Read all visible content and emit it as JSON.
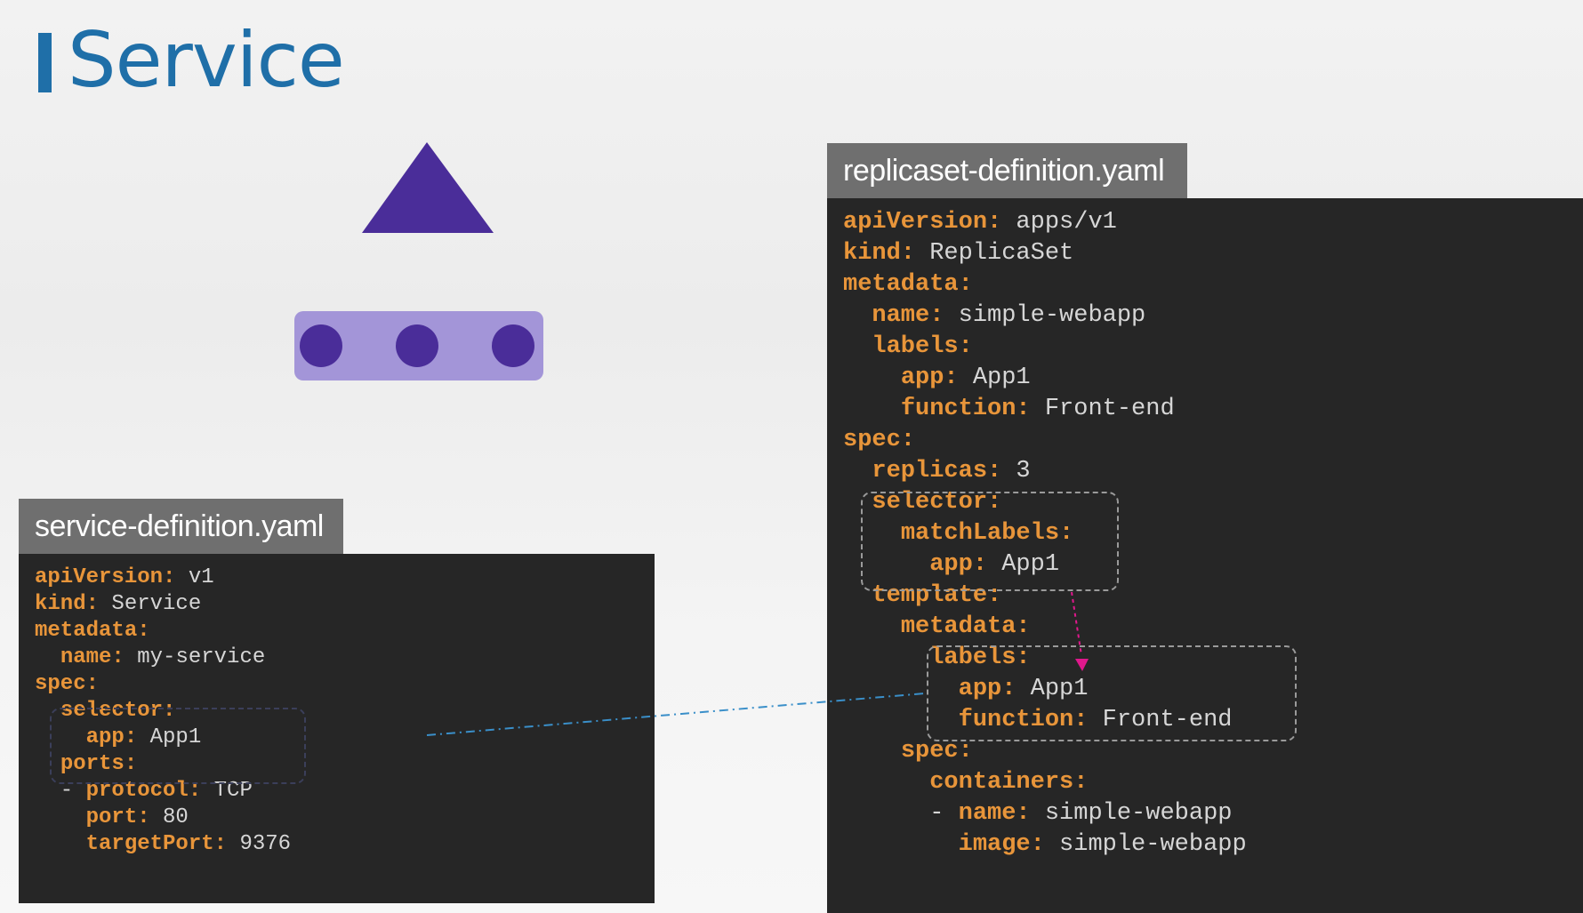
{
  "page": {
    "title": "Service"
  },
  "colors": {
    "accent_blue": "#1f6fa8",
    "triangle": "#4a2d99",
    "pod_group_bg": "#a395d8",
    "pod": "#4a2d99",
    "connector_blue": "#3a8fc9",
    "arrow_magenta": "#e0188c",
    "yaml_key": "#e8953a",
    "yaml_value": "#d6d6d6",
    "code_bg": "#262626",
    "tab_bg": "#6f6f6f"
  },
  "diagram": {
    "service_icon": "triangle-icon",
    "pods_count": 3
  },
  "service_file": {
    "tab_label": "service-definition.yaml",
    "lines": [
      {
        "indent": "",
        "key": "apiVersion:",
        "value": " v1"
      },
      {
        "indent": "",
        "key": "kind:",
        "value": " Service"
      },
      {
        "indent": "",
        "key": "metadata:",
        "value": ""
      },
      {
        "indent": "  ",
        "key": "name:",
        "value": " my-service"
      },
      {
        "indent": "",
        "key": "spec:",
        "value": ""
      },
      {
        "indent": "  ",
        "key": "selector:",
        "value": ""
      },
      {
        "indent": "    ",
        "key": "app:",
        "value": " App1"
      },
      {
        "indent": "  ",
        "key": "ports:",
        "value": ""
      },
      {
        "indent": "  - ",
        "key": "protocol:",
        "value": " TCP"
      },
      {
        "indent": "    ",
        "key": "port:",
        "value": " 80"
      },
      {
        "indent": "    ",
        "key": "targetPort:",
        "value": " 9376"
      }
    ]
  },
  "replicaset_file": {
    "tab_label": "replicaset-definition.yaml",
    "lines": [
      {
        "indent": "",
        "key": "apiVersion:",
        "value": " apps/v1"
      },
      {
        "indent": "",
        "key": "kind:",
        "value": " ReplicaSet"
      },
      {
        "indent": "",
        "key": "metadata:",
        "value": ""
      },
      {
        "indent": "  ",
        "key": "name:",
        "value": " simple-webapp"
      },
      {
        "indent": "  ",
        "key": "labels:",
        "value": ""
      },
      {
        "indent": "    ",
        "key": "app:",
        "value": " App1"
      },
      {
        "indent": "    ",
        "key": "function:",
        "value": " Front-end"
      },
      {
        "indent": "",
        "key": "spec:",
        "value": ""
      },
      {
        "indent": "  ",
        "key": "replicas:",
        "value": " 3"
      },
      {
        "indent": "  ",
        "key": "selector:",
        "value": ""
      },
      {
        "indent": "    ",
        "key": "matchLabels:",
        "value": ""
      },
      {
        "indent": "      ",
        "key": "app:",
        "value": " App1"
      },
      {
        "indent": "  ",
        "key": "template:",
        "value": ""
      },
      {
        "indent": "    ",
        "key": "metadata:",
        "value": ""
      },
      {
        "indent": "      ",
        "key": "labels:",
        "value": ""
      },
      {
        "indent": "        ",
        "key": "app:",
        "value": " App1"
      },
      {
        "indent": "        ",
        "key": "function:",
        "value": " Front-end"
      },
      {
        "indent": "    ",
        "key": "spec:",
        "value": ""
      },
      {
        "indent": "      ",
        "key": "containers:",
        "value": ""
      },
      {
        "indent": "      - ",
        "key": "name:",
        "value": " simple-webapp"
      },
      {
        "indent": "        ",
        "key": "image:",
        "value": " simple-webapp"
      }
    ]
  }
}
